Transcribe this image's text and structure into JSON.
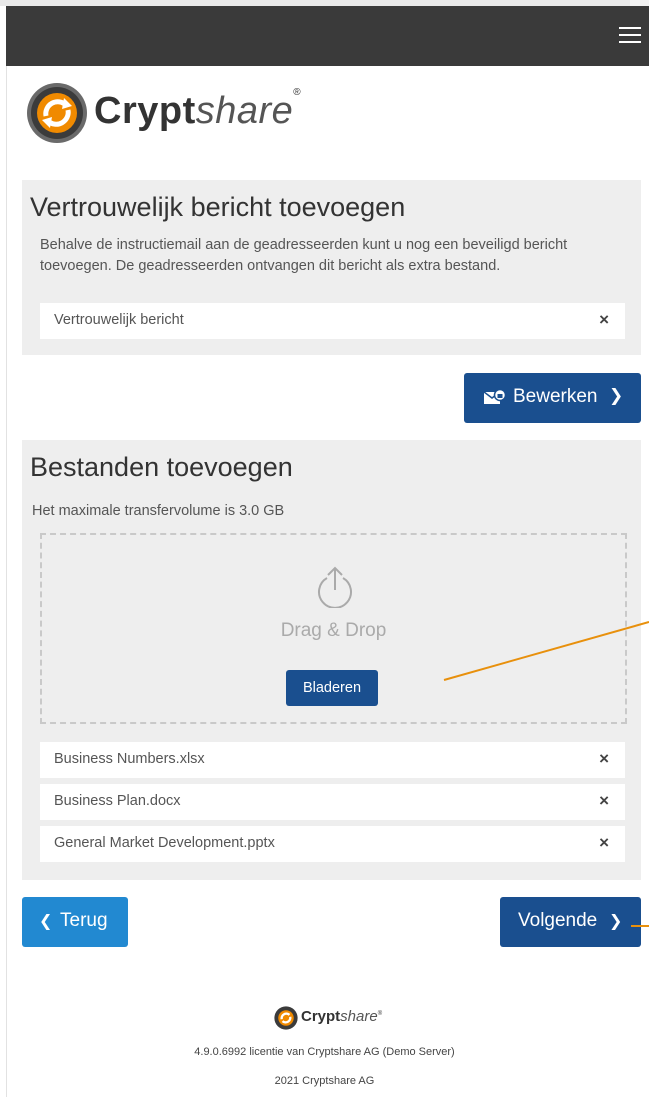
{
  "header": {
    "menu_icon": "hamburger-icon"
  },
  "brand": {
    "name_bold": "Crypt",
    "name_italic": "share",
    "mark": "®"
  },
  "message_section": {
    "title": "Vertrouwelijk bericht toevoegen",
    "description": "Behalve de instructiemail aan de geadresseerden kunt u nog een beveiligd bericht toevoegen. De geadresseerden ontvangen dit bericht als extra bestand.",
    "item_label": "Vertrouwelijk bericht",
    "remove_icon": "×",
    "edit_button": "Bewerken",
    "edit_icon": "envelope-lock-icon",
    "edit_chevron": "❯"
  },
  "files_section": {
    "title": "Bestanden toevoegen",
    "max_volume": "Het maximale transfervolume is 3.0 GB",
    "drop_text": "Drag & Drop",
    "browse_button": "Bladeren",
    "files": [
      {
        "name": "Business Numbers.xlsx"
      },
      {
        "name": "Business Plan.docx"
      },
      {
        "name": "General Market Development.pptx"
      }
    ],
    "remove_icon": "×"
  },
  "nav": {
    "back_label": "Terug",
    "back_chevron": "❮",
    "next_label": "Volgende",
    "next_chevron": "❯"
  },
  "footer": {
    "brand_bold": "Crypt",
    "brand_italic": "share",
    "brand_mark": "®",
    "version": "4.9.0.6992 licentie van Cryptshare AG (Demo Server)",
    "copyright": "2021 Cryptshare AG"
  },
  "colors": {
    "navbar": "#3a3a3a",
    "primary_button": "#1a4f8f",
    "back_button": "#2289d1",
    "panel": "#eeeeee",
    "annotation": "#e8900c"
  }
}
